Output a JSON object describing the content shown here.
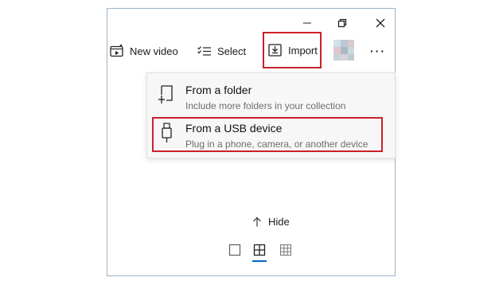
{
  "window": {
    "controls": [
      "minimize",
      "restore",
      "close"
    ]
  },
  "toolbar": {
    "new_video_label": "New video",
    "select_label": "Select",
    "import_label": "Import",
    "more_label": "···"
  },
  "import_menu": {
    "items": [
      {
        "title": "From a folder",
        "description": "Include more folders in your collection",
        "icon": "folder-add-icon"
      },
      {
        "title": "From a USB device",
        "description": "Plug in a phone, camera, or another device",
        "icon": "usb-device-icon"
      }
    ]
  },
  "gallery": {
    "hide_label": "Hide",
    "views": [
      "single-view",
      "grid-view",
      "dense-grid-view"
    ],
    "selected_view": "grid-view"
  },
  "colors": {
    "highlight": "#cc2029",
    "accent": "#0067c0"
  }
}
